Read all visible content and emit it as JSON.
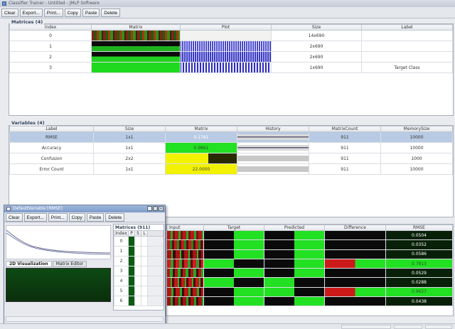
{
  "window": {
    "title": "Classifier Trainer - Untitled - JMLP Software"
  },
  "toolbar": {
    "clear": "Clear",
    "export": "Export...",
    "print": "Print...",
    "copy": "Copy",
    "paste": "Paste",
    "delete": "Delete"
  },
  "matrices": {
    "title": "Matrices (4)",
    "headers": [
      "Index",
      "Matrix",
      "Plot",
      "Size",
      "Label"
    ],
    "rows": [
      {
        "index": "0",
        "size": "14x690",
        "label": ""
      },
      {
        "index": "1",
        "size": "2x690",
        "label": ""
      },
      {
        "index": "2",
        "size": "2x690",
        "label": ""
      },
      {
        "index": "3",
        "size": "1x690",
        "label": "Target Class"
      }
    ]
  },
  "variables": {
    "title": "Variables (4)",
    "headers": [
      "Label",
      "Size",
      "Matrix",
      "History",
      "MatrixCount",
      "MemorySize"
    ],
    "rows": [
      {
        "label": "RMSE",
        "size": "1x1",
        "matrix": "0.1761",
        "count": "911",
        "memory": "10000",
        "style": "dark"
      },
      {
        "label": "Accuracy",
        "size": "1x1",
        "matrix": "0.9861",
        "count": "911",
        "memory": "10000",
        "style": "green"
      },
      {
        "label": "Confusion",
        "size": "2x2",
        "matrix": "",
        "count": "911",
        "memory": "1000",
        "style": "mixed"
      },
      {
        "label": "Error Count",
        "size": "1x1",
        "matrix": "22.0000",
        "count": "911",
        "memory": "10000",
        "style": "yellow"
      }
    ]
  },
  "subwindow": {
    "title": "DefaultVariable [RMSE]",
    "toolbar": {
      "clear": "Clear",
      "export": "Export...",
      "print": "Print...",
      "copy": "Copy",
      "paste": "Paste",
      "delete": "Delete"
    },
    "tabs": [
      "2D Visualization",
      "Matrix Editor"
    ],
    "matrices_title": "Matrices (911)",
    "matrices_headers": [
      "Index",
      "P",
      "S",
      "L"
    ],
    "matrices_rows": [
      "0",
      "1",
      "2",
      "3",
      "4",
      "5",
      "6"
    ]
  },
  "results": {
    "headers": [
      "Input",
      "Target",
      "Predicted",
      "Difference",
      "RMSE"
    ],
    "rmse_values": [
      "0.0504",
      "0.0352",
      "0.0586",
      "0.7813",
      "0.0529",
      "0.0288",
      "0.9627",
      "0.0438"
    ]
  },
  "colors": {
    "accent": "#b9cbe4",
    "dark_green": "#0c260c",
    "bright_green": "#22e022",
    "yellow": "#f1f100",
    "red": "#cc1a1a"
  }
}
